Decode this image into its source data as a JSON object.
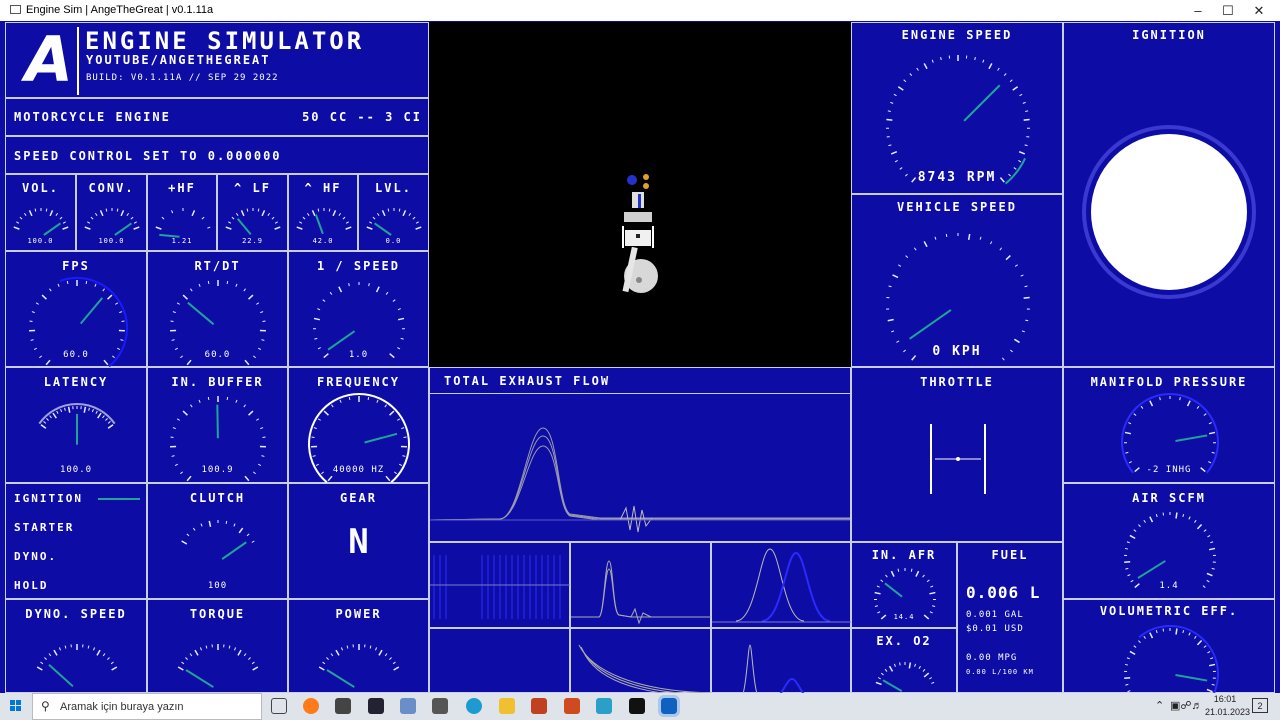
{
  "window": {
    "title": "Engine Sim | AngeTheGreat | v0.1.11a"
  },
  "header": {
    "logo_letter": "A",
    "title": "ENGINE SIMULATOR",
    "subtitle": "YOUTUBE/ANGETHEGREAT",
    "build": "BUILD: V0.1.11A // SEP 29 2022"
  },
  "engine": {
    "name": "MOTORCYCLE ENGINE",
    "displacement": "50 CC -- 3 CI"
  },
  "speed_control": "SPEED CONTROL SET TO 0.000000",
  "mixer": [
    {
      "label": "VOL.",
      "value": "100.0"
    },
    {
      "label": "CONV.",
      "value": "100.0"
    },
    {
      "label": "+HF",
      "value": "1.21"
    },
    {
      "label": "^ LF",
      "value": "22.9"
    },
    {
      "label": "^ HF",
      "value": "42.0"
    },
    {
      "label": "LVL.",
      "value": "0.0"
    }
  ],
  "perf": [
    {
      "label": "FPS",
      "value": "60.0"
    },
    {
      "label": "RT/DT",
      "value": "60.0"
    },
    {
      "label": "1 / SPEED",
      "value": "1.0"
    },
    {
      "label": "LATENCY",
      "value": "100.0"
    },
    {
      "label": "IN. BUFFER",
      "value": "100.9"
    },
    {
      "label": "FREQUENCY",
      "value": "40000 HZ"
    }
  ],
  "controls": [
    "IGNITION",
    "STARTER",
    "DYNO.",
    "HOLD"
  ],
  "clutch": {
    "label": "CLUTCH",
    "value": "100"
  },
  "gear": {
    "label": "GEAR",
    "value": "N"
  },
  "bottom_gauges": [
    {
      "label": "DYNO. SPEED"
    },
    {
      "label": "TORQUE"
    },
    {
      "label": "POWER"
    }
  ],
  "engine_speed": {
    "label": "ENGINE SPEED",
    "value": "8743 RPM"
  },
  "vehicle_speed": {
    "label": "VEHICLE SPEED",
    "value": "0 KPH"
  },
  "ignition_panel": {
    "label": "IGNITION"
  },
  "exhaust": {
    "label": "TOTAL EXHAUST FLOW"
  },
  "throttle": {
    "label": "THROTTLE"
  },
  "manifold": {
    "label": "MANIFOLD PRESSURE",
    "value": "-2 INHG"
  },
  "air_scfm": {
    "label": "AIR SCFM",
    "value": "1.4"
  },
  "in_afr": {
    "label": "IN. AFR",
    "value": "14.4"
  },
  "ex_o2": {
    "label": "EX. O2"
  },
  "fuel": {
    "label": "FUEL",
    "main": "0.006 L",
    "gal": "0.001 GAL",
    "usd": "$0.01 USD",
    "mpg": "0.00 MPG",
    "lkm": "0.00 L/100 KM"
  },
  "vol_eff": {
    "label": "VOLUMETRIC EFF."
  },
  "taskbar": {
    "search_placeholder": "Aramak için buraya yazın",
    "time": "16:01",
    "date": "21.01.2023",
    "notif": "2"
  },
  "colors": {
    "bg": "#0d0da6",
    "needle": "#1fa39a",
    "border": "#c9cdf0",
    "accent_blue": "#2a2aff"
  }
}
